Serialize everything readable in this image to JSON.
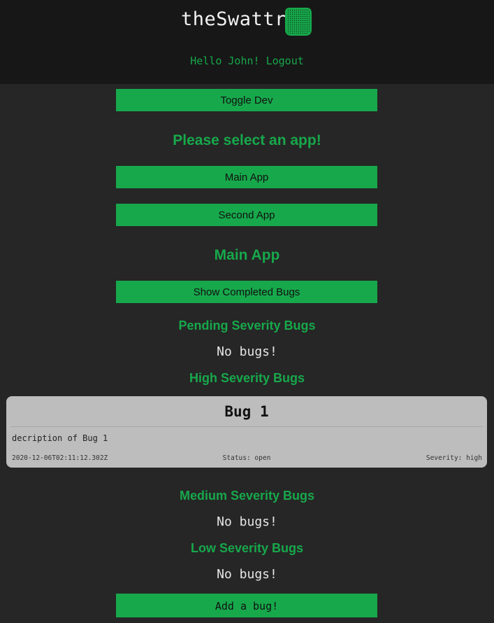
{
  "header": {
    "logo_text": "theSwattr",
    "logo_icon": "swatter-icon",
    "greeting": "Hello John!",
    "logout_label": "Logout"
  },
  "controls": {
    "toggle_dev_label": "Toggle Dev",
    "select_prompt": "Please select an app!",
    "apps": [
      {
        "label": "Main App"
      },
      {
        "label": "Second App"
      }
    ]
  },
  "main": {
    "app_title": "Main App",
    "show_completed_label": "Show Completed Bugs",
    "sections": {
      "pending": {
        "title": "Pending Severity Bugs",
        "empty_text": "No bugs!"
      },
      "high": {
        "title": "High Severity Bugs",
        "bugs": [
          {
            "name": "Bug 1",
            "description": "decription of Bug 1",
            "created": "2020-12-06T02:11:12.302Z",
            "status": "Status: open",
            "severity": "Severity: high"
          }
        ]
      },
      "medium": {
        "title": "Medium Severity Bugs",
        "empty_text": "No bugs!"
      },
      "low": {
        "title": "Low Severity Bugs",
        "empty_text": "No bugs!"
      }
    },
    "add_bug_label": "Add a bug!"
  },
  "colors": {
    "accent": "#17a84b",
    "header_bg": "#171717",
    "page_bg": "#262626",
    "card_bg": "#bdbdbd"
  }
}
